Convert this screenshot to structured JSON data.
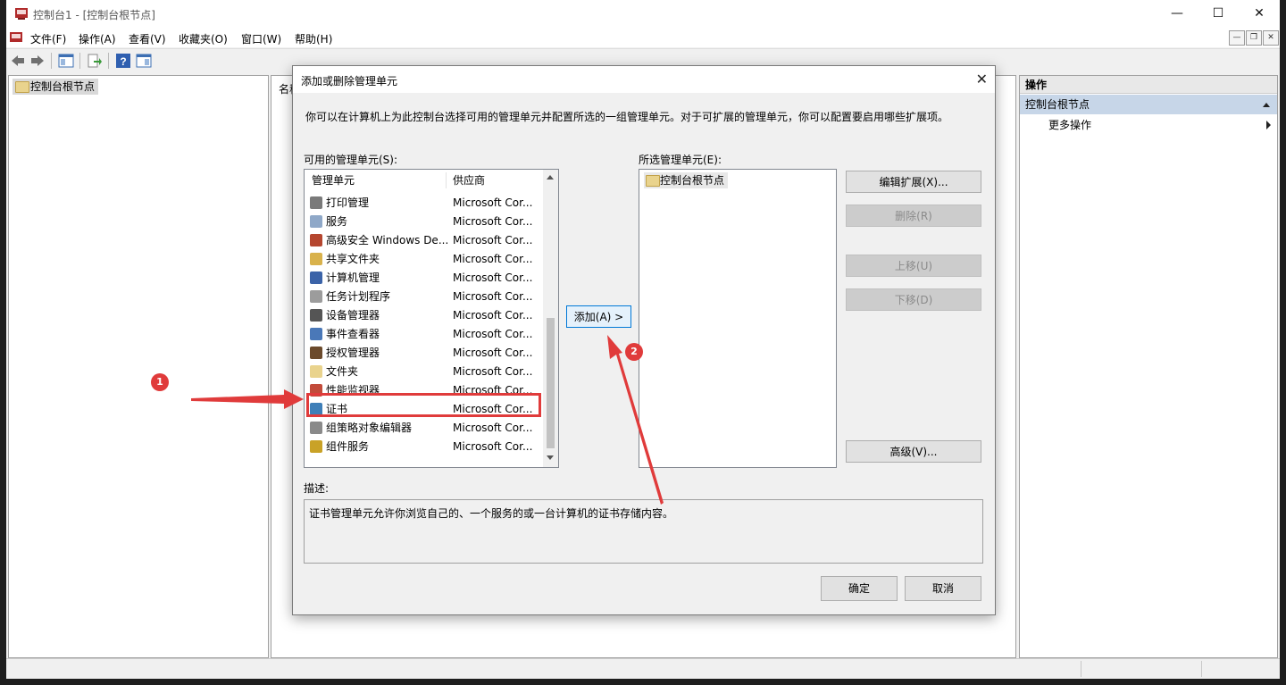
{
  "window": {
    "title": "控制台1 - [控制台根节点]",
    "minimize": "—",
    "maximize": "☐",
    "close": "✕"
  },
  "menu": {
    "items": [
      "文件(F)",
      "操作(A)",
      "查看(V)",
      "收藏夹(O)",
      "窗口(W)",
      "帮助(H)"
    ]
  },
  "mdi": {
    "min": "—",
    "restore": "❐",
    "close": "✕"
  },
  "tree": {
    "root": "控制台根节点"
  },
  "middle": {
    "column_partial": "名称"
  },
  "actions": {
    "header": "操作",
    "selected": "控制台根节点",
    "more": "更多操作"
  },
  "dialog": {
    "title": "添加或删除管理单元",
    "close": "✕",
    "intro": "你可以在计算机上为此控制台选择可用的管理单元并配置所选的一组管理单元。对于可扩展的管理单元，你可以配置要启用哪些扩展项。",
    "available_label": "可用的管理单元(S):",
    "selected_label": "所选管理单元(E):",
    "columns": {
      "name": "管理单元",
      "vendor": "供应商"
    },
    "snapins": [
      {
        "name": "打印管理",
        "vendor": "Microsoft Cor...",
        "color": "#7a7a7a"
      },
      {
        "name": "服务",
        "vendor": "Microsoft Cor...",
        "color": "#8fa8c8"
      },
      {
        "name": "高级安全 Windows De...",
        "vendor": "Microsoft Cor...",
        "color": "#b5462f"
      },
      {
        "name": "共享文件夹",
        "vendor": "Microsoft Cor...",
        "color": "#d9b24c"
      },
      {
        "name": "计算机管理",
        "vendor": "Microsoft Cor...",
        "color": "#3b63a8"
      },
      {
        "name": "任务计划程序",
        "vendor": "Microsoft Cor...",
        "color": "#9c9c9c"
      },
      {
        "name": "设备管理器",
        "vendor": "Microsoft Cor...",
        "color": "#555555"
      },
      {
        "name": "事件查看器",
        "vendor": "Microsoft Cor...",
        "color": "#4a78b8"
      },
      {
        "name": "授权管理器",
        "vendor": "Microsoft Cor...",
        "color": "#6b4a2c"
      },
      {
        "name": "文件夹",
        "vendor": "Microsoft Cor...",
        "color": "#e9d38d"
      },
      {
        "name": "性能监视器",
        "vendor": "Microsoft Cor...",
        "color": "#c24b3a"
      },
      {
        "name": "证书",
        "vendor": "Microsoft Cor...",
        "color": "#3f7fb8"
      },
      {
        "name": "组策略对象编辑器",
        "vendor": "Microsoft Cor...",
        "color": "#8a8a8a"
      },
      {
        "name": "组件服务",
        "vendor": "Microsoft Cor...",
        "color": "#c9a227"
      }
    ],
    "selected_items": [
      "控制台根节点"
    ],
    "add_button": "添加(A) >",
    "buttons": {
      "edit_ext": "编辑扩展(X)...",
      "remove": "删除(R)",
      "move_up": "上移(U)",
      "move_down": "下移(D)",
      "advanced": "高级(V)...",
      "ok": "确定",
      "cancel": "取消"
    },
    "desc_label": "描述:",
    "description": "证书管理单元允许你浏览自己的、一个服务的或一台计算机的证书存储内容。"
  },
  "annotations": {
    "step1": "1",
    "step2": "2",
    "color": "#e03b3b"
  }
}
